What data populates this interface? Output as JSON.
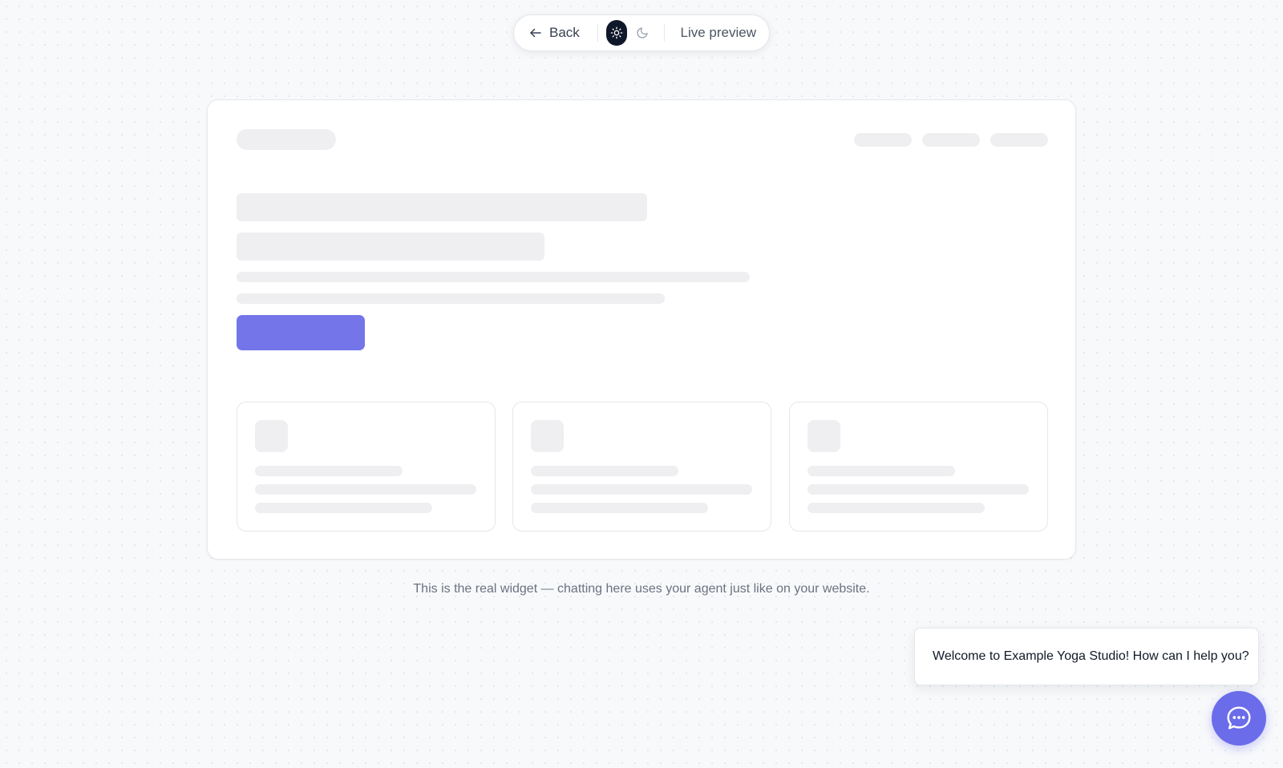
{
  "toolbar": {
    "back_label": "Back",
    "back_icon": "arrow-left-icon",
    "light_icon": "sun-icon",
    "dark_icon": "moon-icon",
    "active_theme": "light",
    "live_preview_label": "Live preview"
  },
  "preview": {
    "skeleton_cards": [
      {
        "name": "feature-card-1"
      },
      {
        "name": "feature-card-2"
      },
      {
        "name": "feature-card-3"
      }
    ]
  },
  "caption": "This is the real widget — chatting here uses your agent just like on your website.",
  "chat": {
    "greeting": "Welcome to Example Yoga Studio! How can I help you?",
    "launcher_icon": "chat-bubble-icon"
  },
  "colors": {
    "accent": "#6a6cea",
    "cta_skeleton": "#7475e9",
    "skeleton": "#efeff1",
    "toolbar_active": "#0f172a",
    "background": "#f8f9fb"
  }
}
